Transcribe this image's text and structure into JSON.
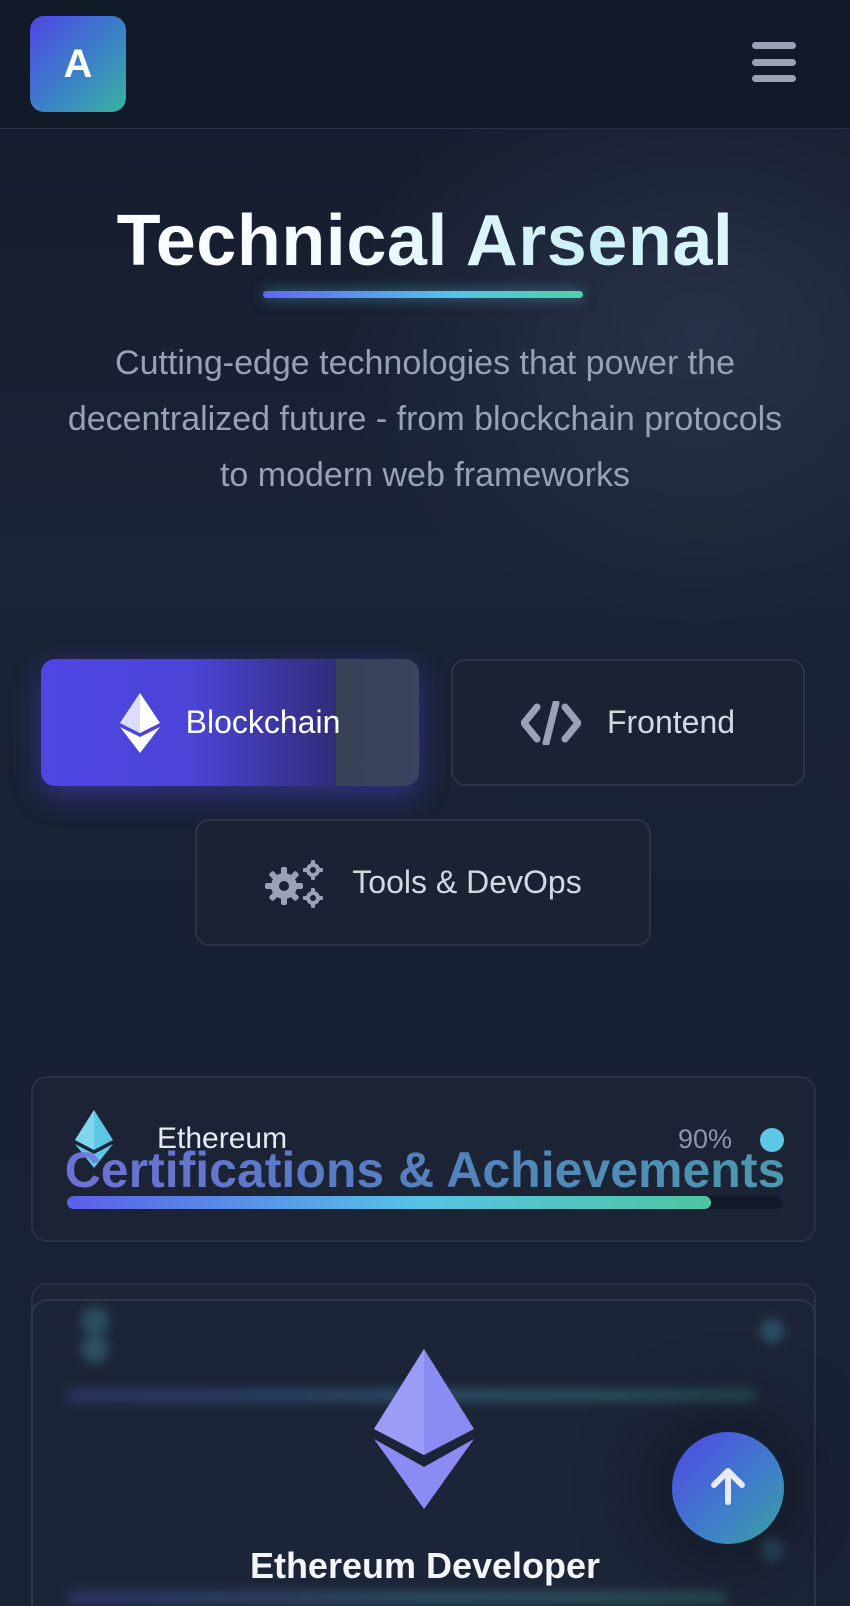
{
  "header": {
    "logo_letter": "A"
  },
  "hero": {
    "title": "Technical Arsenal",
    "subtitle": "Cutting-edge technologies that power the decentralized future - from blockchain protocols to modern web frameworks"
  },
  "tabs": [
    {
      "label": "Blockchain",
      "icon": "ethereum-icon",
      "active": true
    },
    {
      "label": "Frontend",
      "icon": "code-icon",
      "active": false
    },
    {
      "label": "Tools & DevOps",
      "icon": "gears-icon",
      "active": false
    }
  ],
  "skills": [
    {
      "name": "Ethereum",
      "percent_label": "90%",
      "level": 0.9,
      "icon": "ethereum-icon"
    }
  ],
  "certifications": {
    "heading": "Certifications & Achievements",
    "items": [
      {
        "title": "Ethereum Developer",
        "icon": "ethereum-icon"
      }
    ]
  },
  "colors": {
    "accent_indigo": "#4f46e5",
    "accent_cyan": "#56c3e6",
    "accent_teal": "#4fd1a8",
    "background": "#161d2e"
  }
}
